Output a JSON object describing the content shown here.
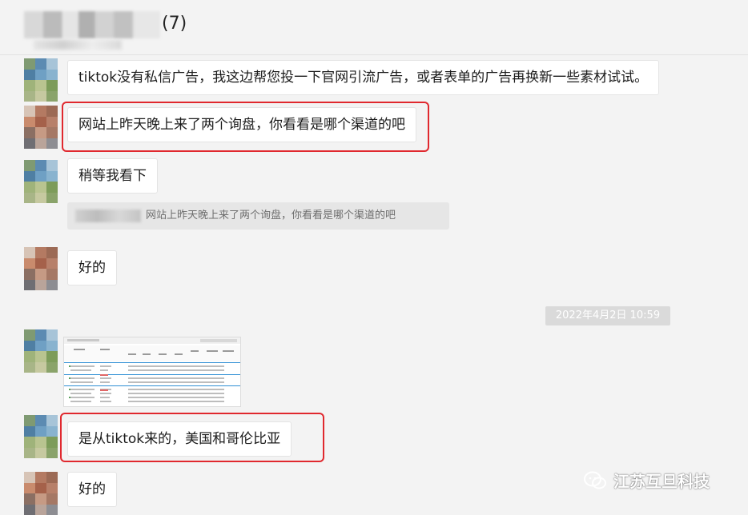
{
  "header": {
    "count": "(7)"
  },
  "messages": [
    {
      "text": "tiktok没有私信广告，我这边帮您投一下官网引流广告，或者表单的广告再换新一些素材试试。"
    },
    {
      "text": "网站上昨天晚上来了两个询盘，你看看是哪个渠道的吧"
    },
    {
      "text": "稍等我看下"
    },
    {
      "quote": "网站上昨天晚上来了两个询盘，你看看是哪个渠道的吧"
    },
    {
      "text": "好的"
    },
    {
      "timestamp": "2022年4月2日 10:59"
    },
    {
      "image": "spreadsheet-screenshot"
    },
    {
      "text": "是从tiktok来的，美国和哥伦比亚"
    },
    {
      "text": "好的"
    }
  ],
  "watermark": {
    "text": "江苏互旦科技"
  },
  "colors": {
    "highlight": "#e0282e",
    "background": "#f3f3f3",
    "bubble": "#ffffff"
  }
}
